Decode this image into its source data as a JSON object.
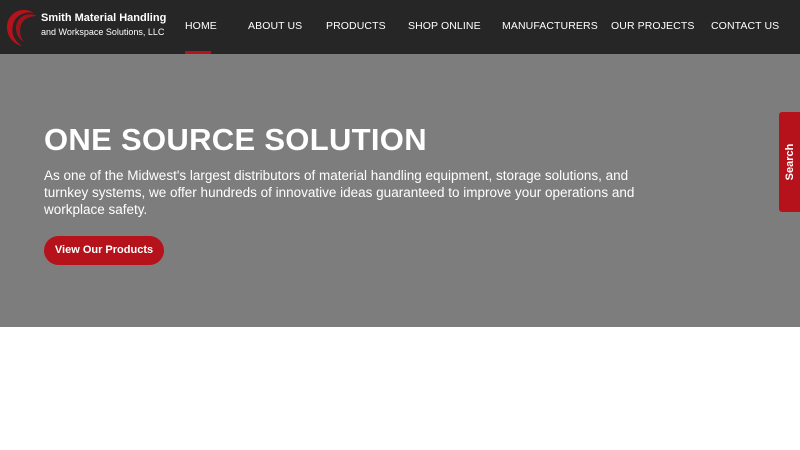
{
  "brand": {
    "name_line1": "Smith Material Handling",
    "name_line2": "and Workspace Solutions, LLC",
    "logo_icon": "red-swoosh-logo-icon",
    "accent_color": "#b5121b"
  },
  "nav": {
    "items": [
      {
        "label": "HOME",
        "active": true
      },
      {
        "label": "ABOUT US",
        "active": false
      },
      {
        "label": "PRODUCTS",
        "active": false
      },
      {
        "label": "SHOP ONLINE",
        "active": false
      },
      {
        "label": "MANUFACTURERS",
        "active": false
      },
      {
        "label": "OUR PROJECTS",
        "active": false
      },
      {
        "label": "CONTACT US",
        "active": false
      }
    ]
  },
  "hero": {
    "title": "ONE SOURCE SOLUTION",
    "description": "As one of the Midwest's largest distributors of material handling equipment, storage solutions, and turnkey systems, we offer hundreds of innovative ideas guaranteed to improve your operations and workplace safety.",
    "cta_label": "View Our Products"
  },
  "search_tab": {
    "label": "Search"
  }
}
